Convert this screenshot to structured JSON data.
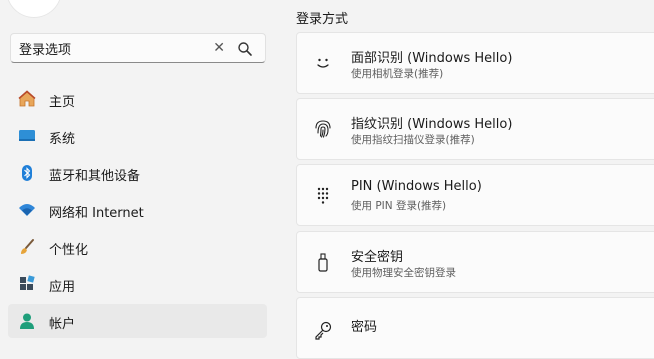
{
  "search": {
    "value": "登录选项",
    "clear_icon": "clear-icon",
    "search_icon": "search-icon"
  },
  "nav": {
    "items": [
      {
        "label": "主页",
        "icon": "home-icon"
      },
      {
        "label": "系统",
        "icon": "system-icon"
      },
      {
        "label": "蓝牙和其他设备",
        "icon": "bluetooth-icon"
      },
      {
        "label": "网络和 Internet",
        "icon": "wifi-icon"
      },
      {
        "label": "个性化",
        "icon": "brush-icon"
      },
      {
        "label": "应用",
        "icon": "apps-icon"
      },
      {
        "label": "帐户",
        "icon": "account-icon",
        "selected": true
      }
    ]
  },
  "main": {
    "section_title": "登录方式",
    "options": [
      {
        "title": "面部识别 (Windows Hello)",
        "subtitle": "使用相机登录(推荐)",
        "icon": "face-icon"
      },
      {
        "title": "指纹识别 (Windows Hello)",
        "subtitle": "使用指纹扫描仪登录(推荐)",
        "icon": "fingerprint-icon"
      },
      {
        "title": "PIN (Windows Hello)",
        "subtitle": "使用 PIN 登录(推荐)",
        "icon": "pin-keypad-icon"
      },
      {
        "title": "安全密钥",
        "subtitle": "使用物理安全密钥登录",
        "icon": "security-key-icon"
      },
      {
        "title": "密码",
        "subtitle": "",
        "icon": "key-icon"
      }
    ]
  },
  "colors": {
    "accent": "#0067c0",
    "background": "#f3f3f3",
    "card": "#fbfbfb"
  }
}
